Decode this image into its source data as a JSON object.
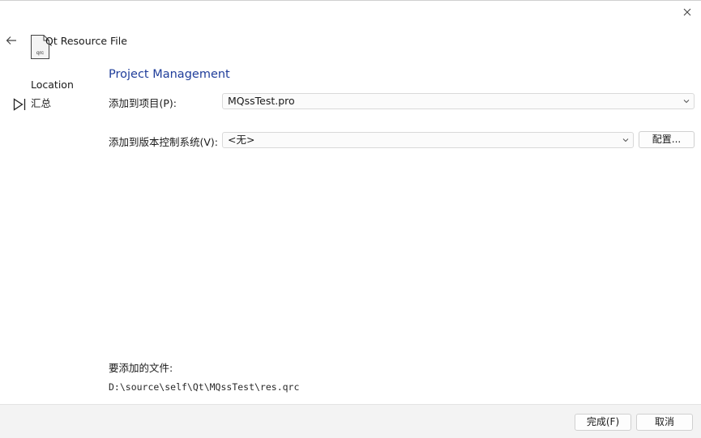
{
  "window": {
    "title": "Qt Resource File",
    "file_icon_label": "qrc"
  },
  "sidebar": {
    "steps": [
      {
        "label": "Location"
      },
      {
        "label": "汇总"
      }
    ]
  },
  "main": {
    "page_title": "Project Management",
    "add_to_project": {
      "label": "添加到项目(P):",
      "value": "MQssTest.pro"
    },
    "add_to_vcs": {
      "label": "添加到版本控制系统(V):",
      "value": "<无>",
      "configure_label": "配置..."
    },
    "files_to_add": {
      "label": "要添加的文件:",
      "path": "D:\\source\\self\\Qt\\MQssTest\\res.qrc"
    }
  },
  "footer": {
    "finish_label": "完成(F)",
    "cancel_label": "取消"
  },
  "colors": {
    "accent_title": "#1f3d9a",
    "footer_bg": "#f3f3f3"
  }
}
